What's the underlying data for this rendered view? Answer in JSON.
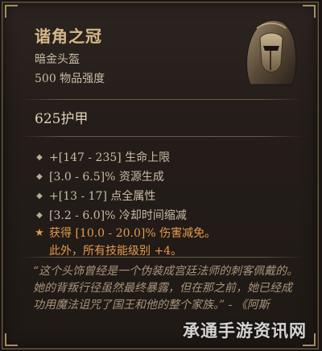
{
  "item": {
    "name": "谐角之冠",
    "type": "暗金头盔",
    "item_power": "500 物品强度",
    "armor": "625护甲"
  },
  "affixes": [
    "+[147 - 235] 生命上限",
    "[3.0 - 6.5]% 资源生成",
    "+[13 - 17] 点全属性",
    "[3.2 - 6.0]% 冷却时间缩减"
  ],
  "unique_power": {
    "line1": "获得 [10.0 - 20.0]% 伤害减免。",
    "line2": "此外，所有技能级别 +4。"
  },
  "flavor_text": "“这个头饰曾经是一个伪装成宫廷法师的刺客佩戴的。她的背叛行径虽然最终暴露，但在那之前，她已经成功用魔法诅咒了国王和他的整个家族。” - 《阿斯",
  "watermark": "承通手游资讯网",
  "icons": {
    "affix_bullet": "diamond-bullet-icon",
    "unique_bullet": "star-icon",
    "item_image": "helmet-icon"
  },
  "colors": {
    "title": "#d6b98a",
    "unique_power": "#e49a4c",
    "flavor": "#a89478"
  }
}
